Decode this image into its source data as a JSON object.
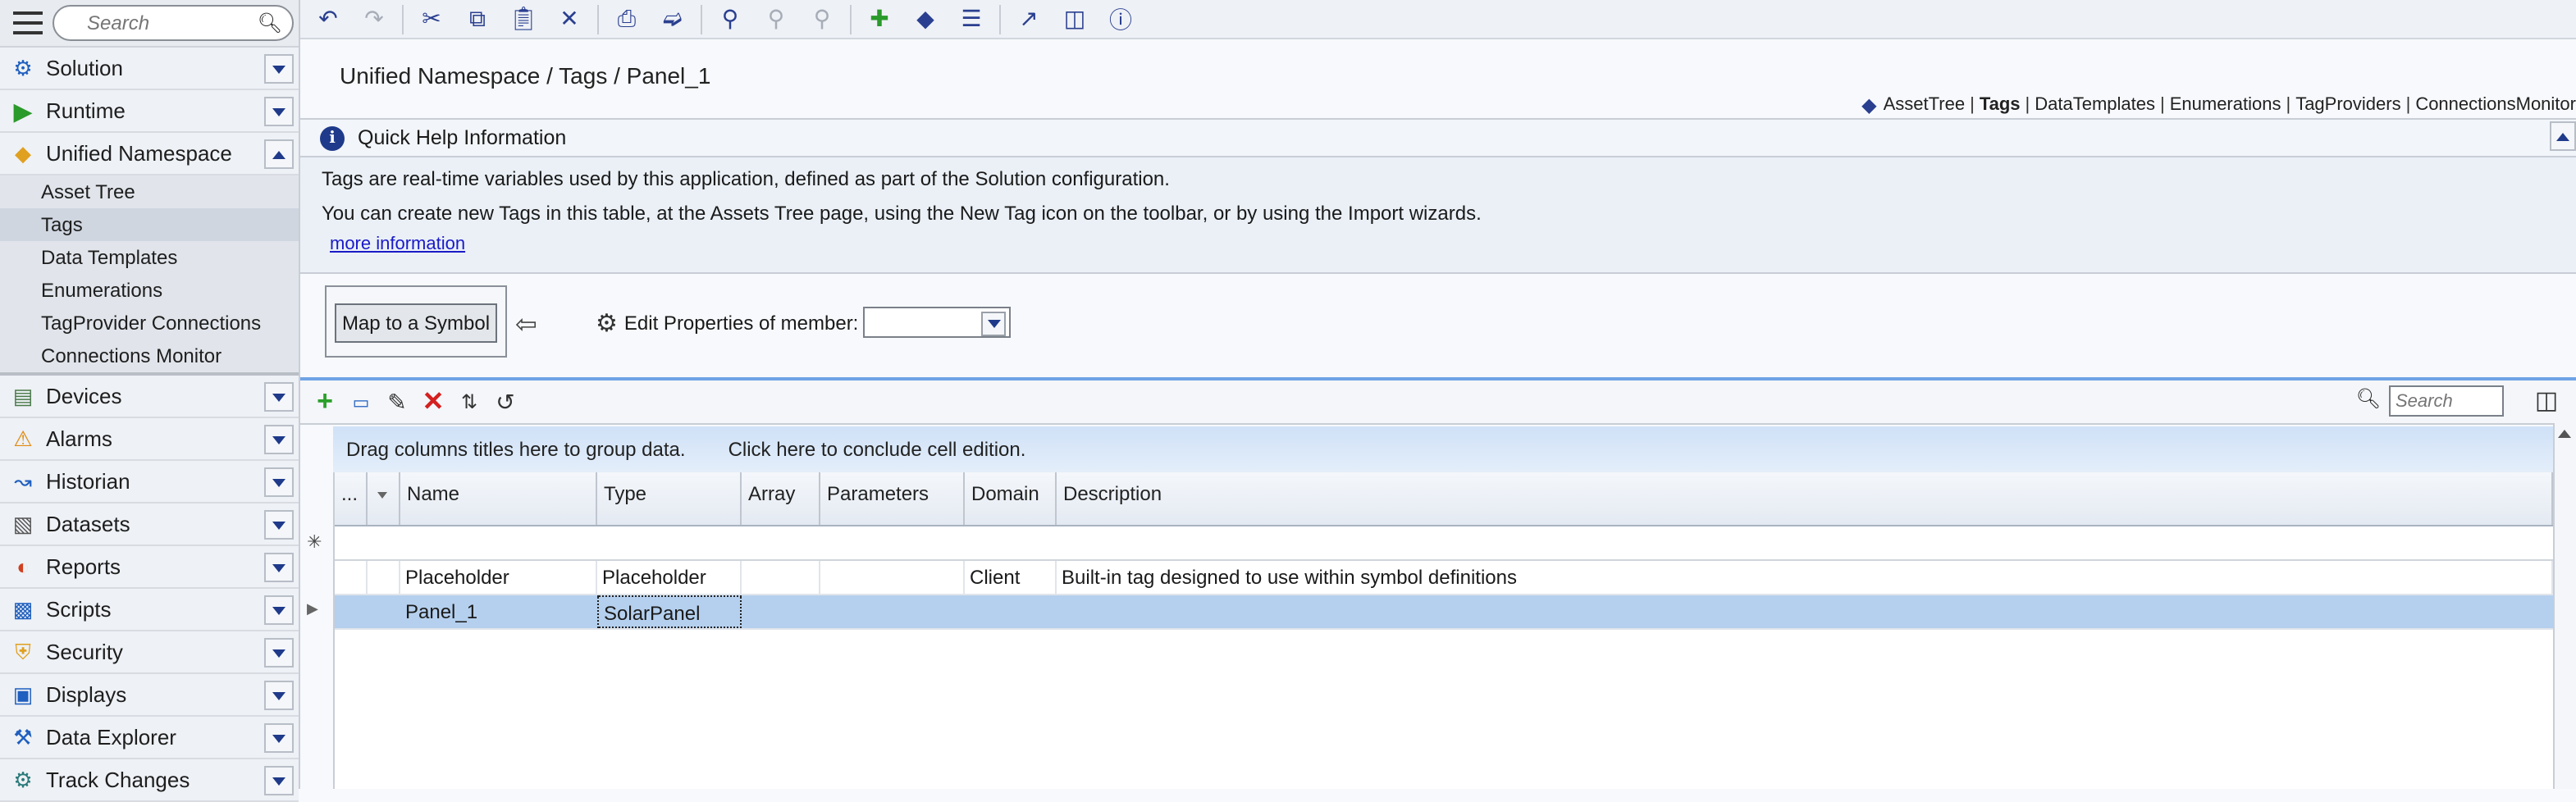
{
  "sidebar": {
    "search_placeholder": "Search",
    "items": [
      {
        "label": "Solution",
        "icon": "gear-icon"
      },
      {
        "label": "Runtime",
        "icon": "play-icon"
      },
      {
        "label": "Unified Namespace",
        "icon": "tag-icon"
      },
      {
        "label": "Devices",
        "icon": "device-icon"
      },
      {
        "label": "Alarms",
        "icon": "warning-icon"
      },
      {
        "label": "Historian",
        "icon": "chart-icon"
      },
      {
        "label": "Datasets",
        "icon": "database-icon"
      },
      {
        "label": "Reports",
        "icon": "report-icon"
      },
      {
        "label": "Scripts",
        "icon": "script-icon"
      },
      {
        "label": "Security",
        "icon": "shield-icon"
      },
      {
        "label": "Displays",
        "icon": "display-icon"
      },
      {
        "label": "Data Explorer",
        "icon": "wrench-icon"
      },
      {
        "label": "Track Changes",
        "icon": "gears-icon"
      }
    ],
    "subitems": [
      "Asset Tree",
      "Tags",
      "Data Templates",
      "Enumerations",
      "TagProvider Connections",
      "Connections Monitor"
    ]
  },
  "header": {
    "breadcrumb": "Unified Namespace / Tags / Panel_1",
    "links": [
      "AssetTree",
      "Tags",
      "DataTemplates",
      "Enumerations",
      "TagProviders",
      "ConnectionsMonitor"
    ],
    "link_separator": "|"
  },
  "quick_help": {
    "title": "Quick Help Information",
    "line1": "Tags are real-time variables used by this application, defined as part of the Solution configuration.",
    "line2": "You can create new Tags in this table, at the Assets Tree page, using the New Tag icon on the toolbar, or by using the Import wizards.",
    "more": "more information"
  },
  "mapping": {
    "map_button": "Map to a Symbol",
    "edit_label": "Edit Properties of member:",
    "member_value": ""
  },
  "grid": {
    "search_placeholder": "Search",
    "group_hint": "Drag columns titles here to group data.",
    "conclude_hint": "Click here to conclude cell edition.",
    "columns": [
      "...",
      "",
      "Name",
      "Type",
      "Array",
      "Parameters",
      "Domain",
      "Description"
    ],
    "new_row_marker": "✳",
    "rows": [
      {
        "name": "Placeholder",
        "type": "Placeholder",
        "array": "",
        "parameters": "",
        "domain": "Client",
        "description": "Built-in tag designed to use within symbol definitions"
      },
      {
        "name": "Panel_1",
        "type": "SolarPanel",
        "array": "",
        "parameters": "",
        "domain": "",
        "description": ""
      }
    ]
  },
  "colors": {
    "accent": "#1f3a8a",
    "selection": "#b5d0ee",
    "group_bar": "#d6e6f8"
  }
}
